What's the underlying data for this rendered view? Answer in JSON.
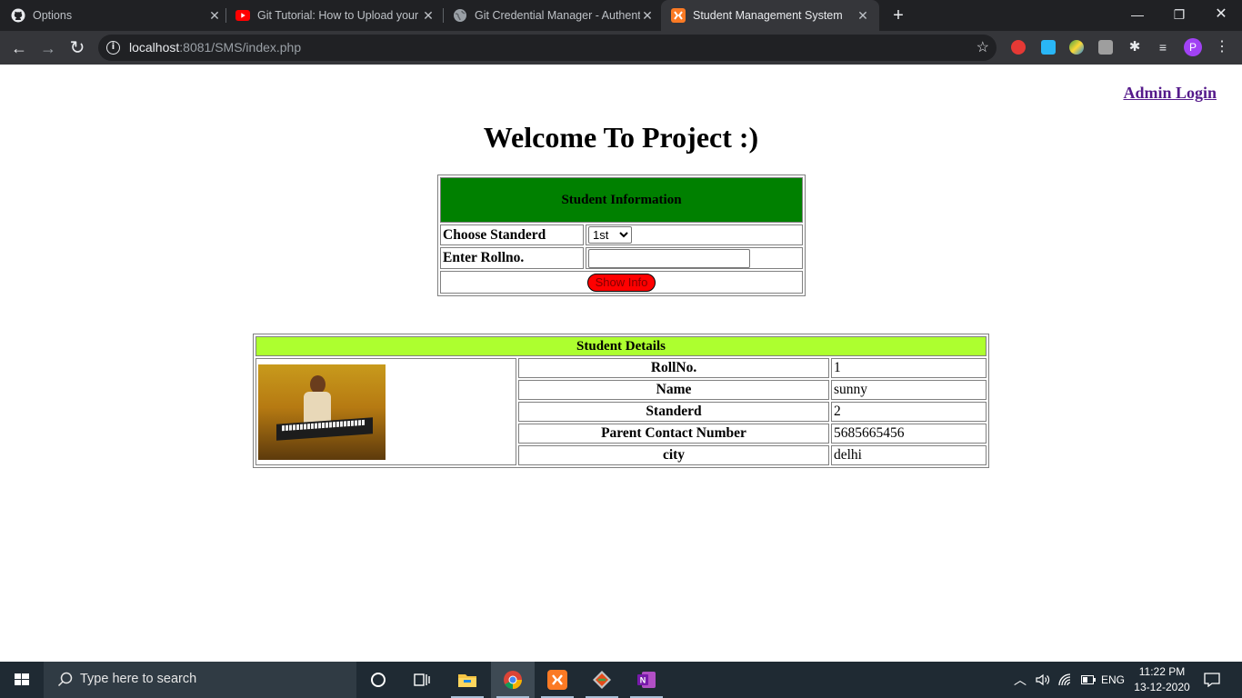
{
  "browser": {
    "tabs": [
      {
        "title": "Options",
        "icon": "github-icon"
      },
      {
        "title": "Git Tutorial: How to Upload your",
        "icon": "youtube-icon"
      },
      {
        "title": "Git Credential Manager - Authent",
        "icon": "globe-icon"
      },
      {
        "title": "Student Management System",
        "icon": "xampp-icon",
        "active": true
      }
    ],
    "url_host": "localhost",
    "url_path": ":8081/SMS/index.php",
    "new_tab": "+",
    "profile_initial": "P"
  },
  "page": {
    "admin_login": "Admin Login",
    "welcome": "Welcome To Project :)",
    "info_form": {
      "heading": "Student Information",
      "standard_label": "Choose Standerd",
      "standard_options": [
        "1st"
      ],
      "standard_selected": "1st",
      "rollno_label": "Enter Rollno.",
      "rollno_value": "",
      "submit_label": "Show Info"
    },
    "details": {
      "heading": "Student Details",
      "rows": [
        {
          "key": "RollNo.",
          "value": "1"
        },
        {
          "key": "Name",
          "value": "sunny"
        },
        {
          "key": "Standerd",
          "value": "2"
        },
        {
          "key": "Parent Contact Number",
          "value": "5685665456"
        },
        {
          "key": "city",
          "value": "delhi"
        }
      ]
    },
    "colors": {
      "info_header": "#008000",
      "details_header": "#adff2f",
      "button": "#ff0000",
      "link": "#551a8b"
    }
  },
  "taskbar": {
    "search_placeholder": "Type here to search",
    "language": "ENG",
    "time": "11:22 PM",
    "date": "13-12-2020"
  }
}
